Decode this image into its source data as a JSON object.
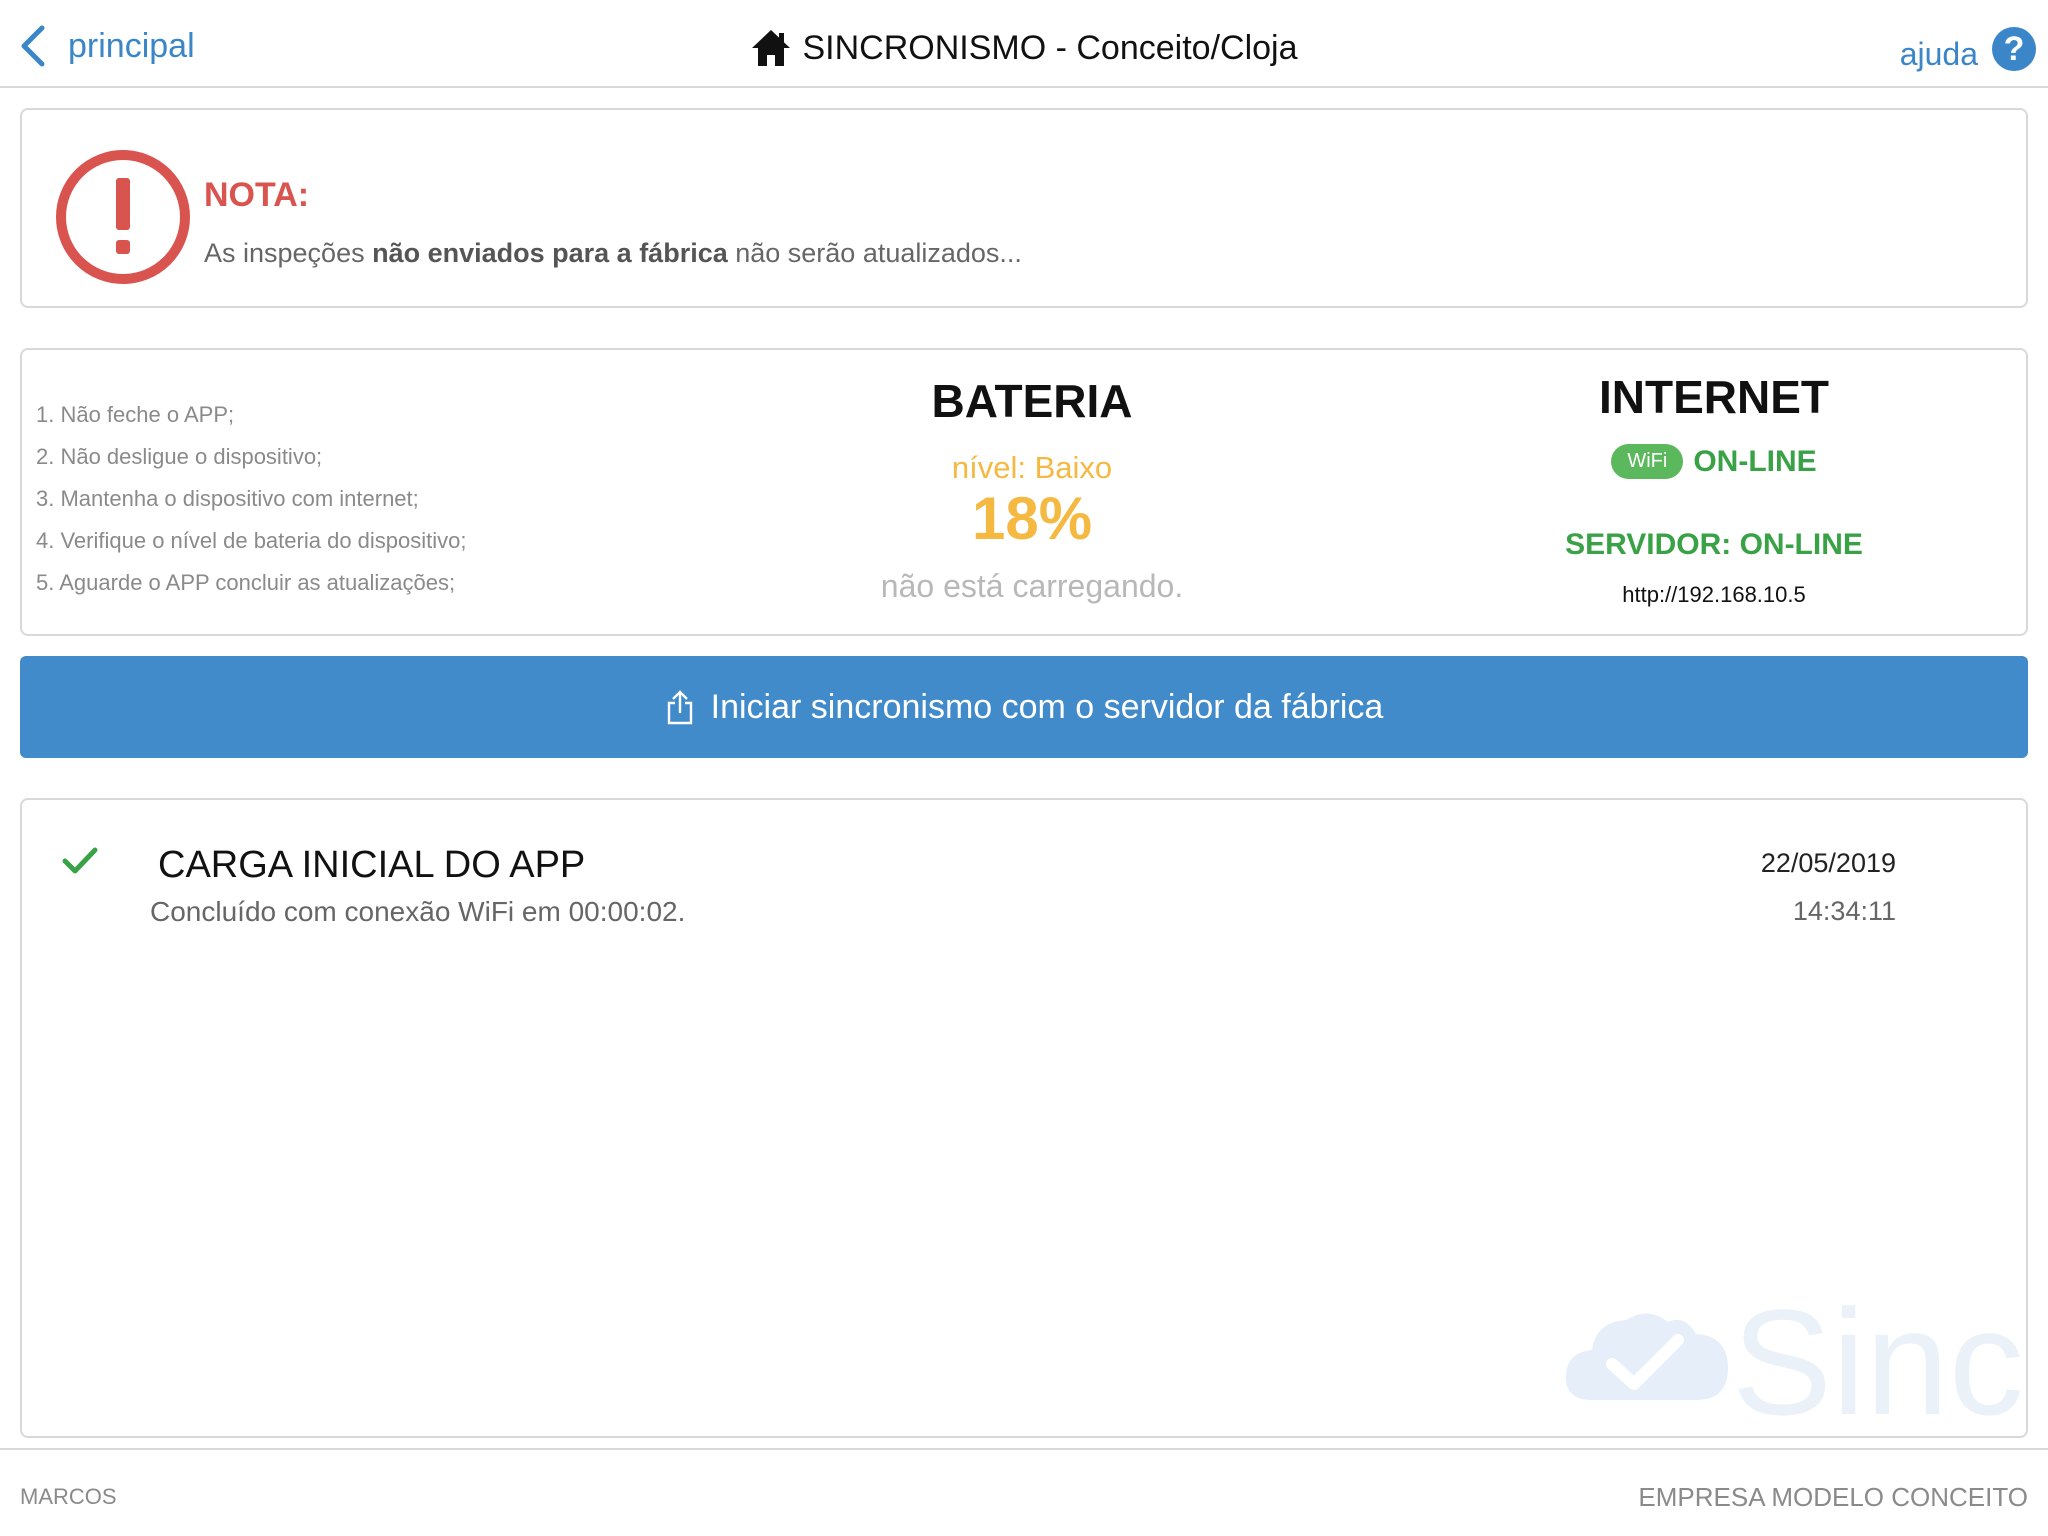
{
  "header": {
    "back_label": "principal",
    "title": "SINCRONISMO - Conceito/Cloja",
    "help_label": "ajuda",
    "help_icon_glyph": "?",
    "icons": {
      "back": "chevron-left-icon",
      "home": "home-icon",
      "help": "help-circle-icon"
    }
  },
  "note": {
    "title": "NOTA:",
    "text_before": "As inspeções ",
    "text_bold": "não enviados para a fábrica",
    "text_after": " não serão atualizados...",
    "icon": "alert-circle-icon"
  },
  "steps": [
    "1. Não feche o APP;",
    "2. Não desligue o dispositivo;",
    "3. Mantenha o dispositivo com internet;",
    "4. Verifique o nível de bateria do dispositivo;",
    "5. Aguarde o APP concluir as atualizações;"
  ],
  "battery": {
    "title": "BATERIA",
    "level_label": "nível: Baixo",
    "percent": "18%",
    "charging_status": "não está carregando."
  },
  "internet": {
    "title": "INTERNET",
    "connection_badge": "WiFi",
    "status": "ON-LINE",
    "server_status": "SERVIDOR: ON-LINE",
    "server_url": "http://192.168.10.5"
  },
  "sync_button": {
    "label": "Iniciar sincronismo com o servidor da fábrica",
    "icon": "share-upload-icon"
  },
  "log": [
    {
      "title": "CARGA INICIAL DO APP",
      "subtitle": "Concluído com conexão WiFi em 00:00:02.",
      "date": "22/05/2019",
      "time": "14:34:11",
      "icon": "check-icon"
    }
  ],
  "watermark": {
    "text": "Sinc",
    "icon": "cloud-check-icon"
  },
  "footer": {
    "user": "MARCOS",
    "company": "EMPRESA MODELO CONCEITO"
  },
  "colors": {
    "primary": "#428bca",
    "link": "#3b86c9",
    "danger": "#d9534f",
    "warning": "#f5b942",
    "success": "#3aa246",
    "wifi_badge": "#5cb85c"
  }
}
